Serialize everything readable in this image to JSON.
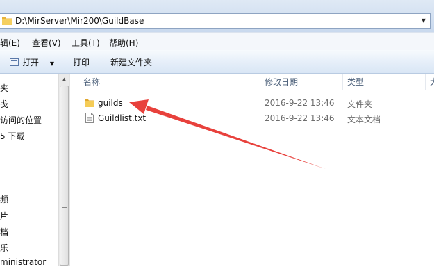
{
  "address": {
    "path": "D:\\MirServer\\Mir200\\GuildBase"
  },
  "menu": [
    "编辑(E)",
    "查看(V)",
    "工具(T)",
    "帮助(H)"
  ],
  "toolbar": {
    "open_label": "打开",
    "print_label": "打印",
    "new_folder_label": "新建文件夹"
  },
  "nav": {
    "items": [
      "夹",
      "戋",
      "访问的位置",
      "5 下载",
      "频",
      "片",
      "档",
      "乐",
      "ministrator"
    ]
  },
  "columns": {
    "name": "名称",
    "modified": "修改日期",
    "type": "类型",
    "size": "大"
  },
  "files": [
    {
      "name": "guilds",
      "modified": "2016-9-22 13:46",
      "type": "文件夹",
      "icon": "folder-icon"
    },
    {
      "name": "Guildlist.txt",
      "modified": "2016-9-22 13:46",
      "type": "文本文档",
      "icon": "text-file-icon"
    }
  ],
  "colors": {
    "accent": "#e8413c",
    "header_text": "#4c607a",
    "folder": "#f1c24b"
  }
}
